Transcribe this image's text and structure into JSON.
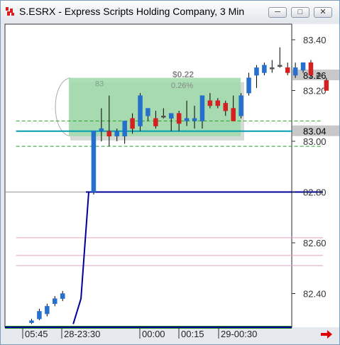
{
  "window": {
    "title": "S.ESRX - Express Scripts Holding Company, 3 Min",
    "minimize_glyph": "─",
    "maximize_glyph": "□",
    "close_glyph": "✕"
  },
  "chart_data": {
    "type": "candlestick",
    "symbol": "S.ESRX",
    "interval": "3 Min",
    "ylim": [
      82.27,
      83.52
    ],
    "y_ticks": [
      83.4,
      83.2,
      83.0,
      82.8,
      82.6,
      82.4
    ],
    "y_tick_labels": [
      "83.40",
      "83.20",
      "83.00",
      "82.80",
      "82.60",
      "82.40"
    ],
    "price_markers": [
      {
        "label": "83.26",
        "value": 83.26,
        "color": "#c8c8c8"
      },
      {
        "label": "83.04",
        "value": 83.04,
        "color": "#c8c8c8"
      }
    ],
    "x_tick_labels": [
      "05:45",
      "28-23:30",
      "00:00",
      "00:15",
      "29-00:30"
    ],
    "annotations": {
      "zone_label": "83",
      "dollar_change": "$0.22",
      "percent_change": "0.26%",
      "zone_low": 83.02,
      "zone_high": 83.25
    },
    "candles": [
      {
        "i": 0,
        "o": 82.285,
        "h": 82.3,
        "l": 82.28,
        "c": 82.293
      },
      {
        "i": 1,
        "o": 82.3,
        "h": 82.34,
        "l": 82.295,
        "c": 82.33
      },
      {
        "i": 2,
        "o": 82.32,
        "h": 82.36,
        "l": 82.31,
        "c": 82.35
      },
      {
        "i": 3,
        "o": 82.36,
        "h": 82.39,
        "l": 82.35,
        "c": 82.38
      },
      {
        "i": 4,
        "o": 82.38,
        "h": 82.41,
        "l": 82.37,
        "c": 82.4
      },
      {
        "i": 8,
        "o": 82.8,
        "h": 83.04,
        "l": 82.79,
        "c": 83.04
      },
      {
        "i": 9,
        "o": 83.04,
        "h": 83.13,
        "l": 83.0,
        "c": 83.05
      },
      {
        "i": 10,
        "o": 83.04,
        "h": 83.18,
        "l": 82.98,
        "c": 83.02
      },
      {
        "i": 11,
        "o": 83.02,
        "h": 83.05,
        "l": 83.0,
        "c": 83.04
      },
      {
        "i": 12,
        "o": 83.02,
        "h": 83.08,
        "l": 82.99,
        "c": 83.08
      },
      {
        "i": 13,
        "o": 83.09,
        "h": 83.11,
        "l": 83.03,
        "c": 83.05
      },
      {
        "i": 14,
        "o": 83.06,
        "h": 83.19,
        "l": 83.04,
        "c": 83.18
      },
      {
        "i": 15,
        "o": 83.1,
        "h": 83.13,
        "l": 83.08,
        "c": 83.13
      },
      {
        "i": 16,
        "o": 83.09,
        "h": 83.12,
        "l": 83.05,
        "c": 83.06
      },
      {
        "i": 17,
        "o": 83.1,
        "h": 83.13,
        "l": 83.09,
        "c": 83.1
      },
      {
        "i": 18,
        "o": 83.09,
        "h": 83.11,
        "l": 83.04,
        "c": 83.11
      },
      {
        "i": 19,
        "o": 83.11,
        "h": 83.12,
        "l": 83.04,
        "c": 83.07
      },
      {
        "i": 20,
        "o": 83.08,
        "h": 83.16,
        "l": 83.06,
        "c": 83.09
      },
      {
        "i": 21,
        "o": 83.08,
        "h": 83.14,
        "l": 83.05,
        "c": 83.09
      },
      {
        "i": 22,
        "o": 83.08,
        "h": 83.18,
        "l": 83.05,
        "c": 83.18
      },
      {
        "i": 23,
        "o": 83.16,
        "h": 83.19,
        "l": 83.13,
        "c": 83.14
      },
      {
        "i": 24,
        "o": 83.16,
        "h": 83.17,
        "l": 83.13,
        "c": 83.14
      },
      {
        "i": 25,
        "o": 83.15,
        "h": 83.16,
        "l": 83.1,
        "c": 83.12
      },
      {
        "i": 26,
        "o": 83.13,
        "h": 83.18,
        "l": 83.08,
        "c": 83.08
      },
      {
        "i": 27,
        "o": 83.1,
        "h": 83.19,
        "l": 83.09,
        "c": 83.18
      },
      {
        "i": 28,
        "o": 83.19,
        "h": 83.27,
        "l": 83.18,
        "c": 83.25
      },
      {
        "i": 29,
        "o": 83.26,
        "h": 83.3,
        "l": 83.21,
        "c": 83.29
      },
      {
        "i": 30,
        "o": 83.27,
        "h": 83.31,
        "l": 83.26,
        "c": 83.3
      },
      {
        "i": 31,
        "o": 83.29,
        "h": 83.32,
        "l": 83.27,
        "c": 83.29
      },
      {
        "i": 32,
        "o": 83.3,
        "h": 83.37,
        "l": 83.29,
        "c": 83.3
      },
      {
        "i": 33,
        "o": 83.29,
        "h": 83.31,
        "l": 83.26,
        "c": 83.27
      },
      {
        "i": 34,
        "o": 83.26,
        "h": 83.31,
        "l": 83.25,
        "c": 83.29
      },
      {
        "i": 35,
        "o": 83.28,
        "h": 83.31,
        "l": 83.27,
        "c": 83.31
      },
      {
        "i": 36,
        "o": 83.31,
        "h": 83.32,
        "l": 83.25,
        "c": 83.26
      },
      {
        "i": 37,
        "o": 83.26,
        "h": 83.27,
        "l": 83.25,
        "c": 83.26
      },
      {
        "i": 38,
        "o": 83.24,
        "h": 83.25,
        "l": 83.2,
        "c": 83.2
      }
    ],
    "jump_line": [
      {
        "i": 5,
        "v": 82.28
      },
      {
        "i": 6,
        "v": 82.38
      },
      {
        "i": 7,
        "v": 82.8
      }
    ],
    "horizontal_levels": [
      {
        "from_i": 7,
        "to_i": 37,
        "value": 82.8,
        "color": "#000099",
        "style": "solid"
      },
      {
        "from_i": -2,
        "to_i": 37,
        "value": 83.04,
        "color": "#009fb4",
        "style": "solid"
      },
      {
        "from_i": -2,
        "to_i": 37,
        "value": 83.08,
        "color": "#24a824",
        "style": "dashed"
      },
      {
        "from_i": -2,
        "to_i": 37,
        "value": 82.98,
        "color": "#24a824",
        "style": "dashed"
      },
      {
        "from_i": -2,
        "to_i": 37,
        "value": 82.62,
        "color": "#e0a0c0",
        "style": "solid"
      },
      {
        "from_i": -2,
        "to_i": 37,
        "value": 82.55,
        "color": "#e0a0c0",
        "style": "solid"
      },
      {
        "from_i": -2,
        "to_i": 37,
        "value": 82.51,
        "color": "#e0a0c0",
        "style": "solid"
      }
    ],
    "up_color": "#2470cc",
    "down_color": "#d42020",
    "flat_color": "#555555"
  }
}
